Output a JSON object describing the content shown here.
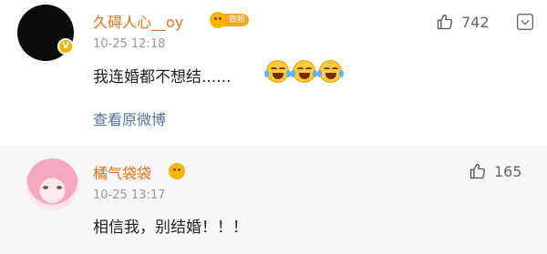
{
  "comments": [
    {
      "username": "久碍人心__oy",
      "badge": "铁粉",
      "time": "10-25 12:18",
      "text": "我连婚都不想结......",
      "likes": "742",
      "link": "查看原微博"
    },
    {
      "username": "橘气袋袋",
      "time": "10-25 13:17",
      "text": "相信我，别结婚！！！",
      "likes": "165"
    }
  ],
  "icons": {
    "thumb": "thumbs-up-icon",
    "more": "chevron-down-icon",
    "emoji": "laughing-crying-emoji-icon",
    "verify": "verified-badge-icon"
  },
  "colors": {
    "username": "#e8701a",
    "link": "#56739b",
    "badge": "#f5a623"
  }
}
